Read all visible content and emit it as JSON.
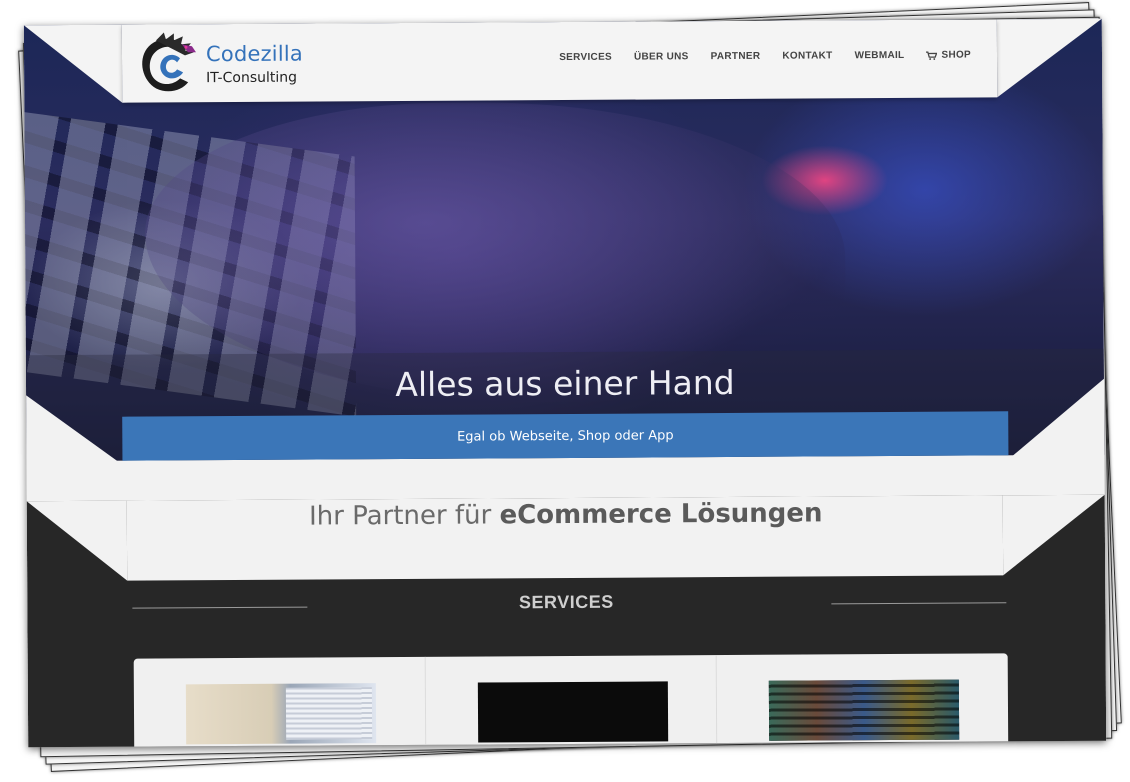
{
  "brand": {
    "name": "Codezilla",
    "subtitle": "IT-Consulting"
  },
  "nav": {
    "items": [
      {
        "label": "SERVICES"
      },
      {
        "label": "ÜBER UNS"
      },
      {
        "label": "PARTNER"
      },
      {
        "label": "KONTAKT"
      },
      {
        "label": "WEBMAIL"
      },
      {
        "label": "SHOP",
        "icon": "cart-icon"
      }
    ]
  },
  "hero": {
    "title": "Alles aus einer Hand",
    "banner": "Egal ob Webseite, Shop oder App"
  },
  "tagline": {
    "prefix": "Ihr Partner für ",
    "highlight": "eCommerce Lösungen"
  },
  "services": {
    "heading": "SERVICES"
  },
  "colors": {
    "accent": "#3b76b8",
    "dark_section": "#272727",
    "light_panel": "#f2f2f2"
  }
}
